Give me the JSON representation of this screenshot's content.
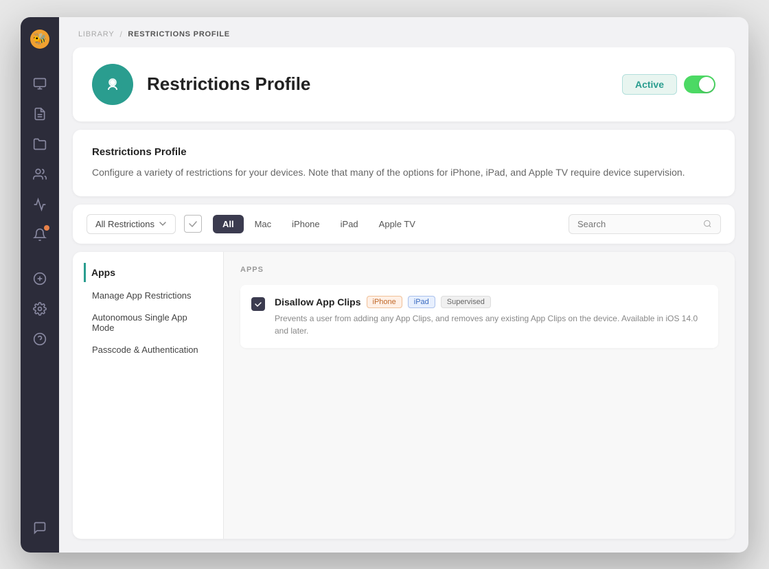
{
  "breadcrumb": {
    "library": "Library",
    "separator": "/",
    "current": "Restrictions Profile"
  },
  "profile": {
    "title": "Restrictions Profile",
    "status": "Active",
    "toggle_on": true
  },
  "description": {
    "title": "Restrictions Profile",
    "text": "Configure a variety of restrictions for your devices. Note that many of the options for iPhone, iPad, and Apple TV require device supervision."
  },
  "filter": {
    "dropdown_label": "All Restrictions",
    "tabs": [
      "All",
      "Mac",
      "iPhone",
      "iPad",
      "Apple TV"
    ],
    "active_tab": "All",
    "search_placeholder": "Search"
  },
  "left_nav": {
    "sections": [
      {
        "header": "Apps",
        "items": [
          "Manage App Restrictions",
          "Autonomous Single App Mode",
          "Passcode & Authentication"
        ]
      }
    ]
  },
  "right_panel": {
    "section_label": "APPS",
    "items": [
      {
        "name": "Disallow App Clips",
        "tags": [
          "iPhone",
          "iPad",
          "Supervised"
        ],
        "description": "Prevents a user from adding any App Clips, and removes any existing App Clips on the device. Available in iOS 14.0 and later.",
        "checked": true
      }
    ]
  },
  "sidebar": {
    "icons": [
      {
        "name": "monitor-icon",
        "symbol": "🖥"
      },
      {
        "name": "document-icon",
        "symbol": "📋"
      },
      {
        "name": "folder-icon",
        "symbol": "📁"
      },
      {
        "name": "users-icon",
        "symbol": "👥"
      },
      {
        "name": "chart-icon",
        "symbol": "📊"
      },
      {
        "name": "bell-icon",
        "symbol": "🔔",
        "badge": true
      },
      {
        "name": "plus-icon",
        "symbol": "+"
      },
      {
        "name": "gear-icon",
        "symbol": "⚙"
      },
      {
        "name": "help-icon",
        "symbol": "?"
      },
      {
        "name": "chat-icon",
        "symbol": "💬"
      }
    ]
  }
}
